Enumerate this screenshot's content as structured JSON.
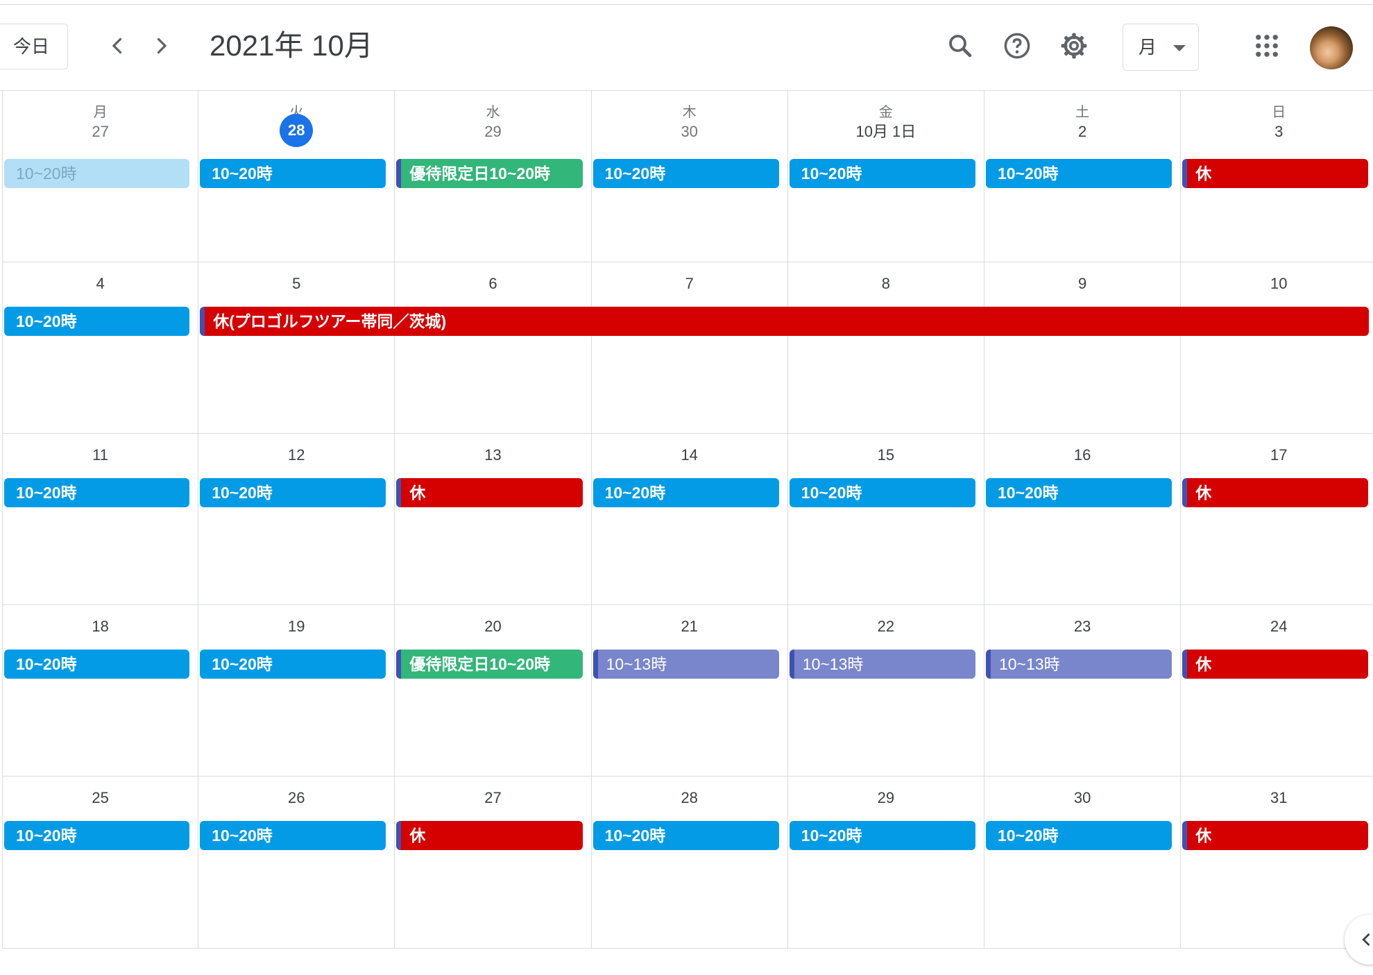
{
  "header": {
    "today_label": "今日",
    "month_title": "2021年 10月",
    "view_label": "月"
  },
  "colors": {
    "blue": "#039be5",
    "red": "#d50000",
    "green": "#33b679",
    "lavender": "#7986cb",
    "today_highlight": "#1a73e8"
  },
  "icons": [
    "chevron-left-icon",
    "chevron-right-icon",
    "search-icon",
    "help-icon",
    "gear-icon",
    "chevron-down-icon",
    "apps-grid-icon",
    "avatar",
    "chevron-left-icon"
  ],
  "weekdays": [
    "月",
    "火",
    "水",
    "木",
    "金",
    "土",
    "日"
  ],
  "weeks": [
    {
      "days": [
        {
          "label": "27",
          "muted": true,
          "events": [
            {
              "title": "10~20時",
              "color": "faded"
            }
          ]
        },
        {
          "label": "28",
          "today": true,
          "events": [
            {
              "title": "10~20時",
              "color": "blue"
            }
          ]
        },
        {
          "label": "29",
          "muted": true,
          "events": [
            {
              "title": "優待限定日10~20時",
              "color": "green"
            }
          ]
        },
        {
          "label": "30",
          "muted": true,
          "events": [
            {
              "title": "10~20時",
              "color": "blue"
            }
          ]
        },
        {
          "label": "10月 1日",
          "events": [
            {
              "title": "10~20時",
              "color": "blue"
            }
          ]
        },
        {
          "label": "2",
          "events": [
            {
              "title": "10~20時",
              "color": "blue"
            }
          ]
        },
        {
          "label": "3",
          "events": [
            {
              "title": "休",
              "color": "red"
            }
          ]
        }
      ]
    },
    {
      "days": [
        {
          "label": "4",
          "events": [
            {
              "title": "10~20時",
              "color": "blue"
            }
          ]
        },
        {
          "label": "5",
          "events": []
        },
        {
          "label": "6",
          "events": []
        },
        {
          "label": "7",
          "events": []
        },
        {
          "label": "8",
          "events": []
        },
        {
          "label": "9",
          "events": []
        },
        {
          "label": "10",
          "events": []
        }
      ],
      "span_events": [
        {
          "title": "休(プロゴルフツアー帯同／茨城)",
          "color": "red",
          "start": 1,
          "end": 6
        }
      ]
    },
    {
      "days": [
        {
          "label": "11",
          "events": [
            {
              "title": "10~20時",
              "color": "blue"
            }
          ]
        },
        {
          "label": "12",
          "events": [
            {
              "title": "10~20時",
              "color": "blue"
            }
          ]
        },
        {
          "label": "13",
          "events": [
            {
              "title": "休",
              "color": "red"
            }
          ]
        },
        {
          "label": "14",
          "events": [
            {
              "title": "10~20時",
              "color": "blue"
            }
          ]
        },
        {
          "label": "15",
          "events": [
            {
              "title": "10~20時",
              "color": "blue"
            }
          ]
        },
        {
          "label": "16",
          "events": [
            {
              "title": "10~20時",
              "color": "blue"
            }
          ]
        },
        {
          "label": "17",
          "events": [
            {
              "title": "休",
              "color": "red"
            }
          ]
        }
      ]
    },
    {
      "days": [
        {
          "label": "18",
          "events": [
            {
              "title": "10~20時",
              "color": "blue"
            }
          ]
        },
        {
          "label": "19",
          "events": [
            {
              "title": "10~20時",
              "color": "blue"
            }
          ]
        },
        {
          "label": "20",
          "events": [
            {
              "title": "優待限定日10~20時",
              "color": "green"
            }
          ]
        },
        {
          "label": "21",
          "events": [
            {
              "title": "10~13時",
              "color": "lavender"
            }
          ]
        },
        {
          "label": "22",
          "events": [
            {
              "title": "10~13時",
              "color": "lavender"
            }
          ]
        },
        {
          "label": "23",
          "events": [
            {
              "title": "10~13時",
              "color": "lavender"
            }
          ]
        },
        {
          "label": "24",
          "events": [
            {
              "title": "休",
              "color": "red"
            }
          ]
        }
      ]
    },
    {
      "days": [
        {
          "label": "25",
          "events": [
            {
              "title": "10~20時",
              "color": "blue"
            }
          ]
        },
        {
          "label": "26",
          "events": [
            {
              "title": "10~20時",
              "color": "blue"
            }
          ]
        },
        {
          "label": "27",
          "events": [
            {
              "title": "休",
              "color": "red"
            }
          ]
        },
        {
          "label": "28",
          "events": [
            {
              "title": "10~20時",
              "color": "blue"
            }
          ]
        },
        {
          "label": "29",
          "events": [
            {
              "title": "10~20時",
              "color": "blue"
            }
          ]
        },
        {
          "label": "30",
          "events": [
            {
              "title": "10~20時",
              "color": "blue"
            }
          ]
        },
        {
          "label": "31",
          "events": [
            {
              "title": "休",
              "color": "red"
            }
          ]
        }
      ]
    }
  ]
}
